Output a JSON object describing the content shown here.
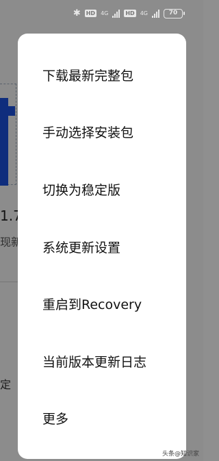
{
  "status_bar": {
    "bluetooth_icon": "bluetooth-icon",
    "hd_badge": "HD",
    "net_label": "4G",
    "battery_level": "70"
  },
  "background": {
    "version_fragment": "1.7",
    "subtitle_fragment": "现新",
    "setting_fragment": "定"
  },
  "menu": {
    "items": [
      {
        "label": "下载最新完整包"
      },
      {
        "label": "手动选择安装包"
      },
      {
        "label": "切换为稳定版"
      },
      {
        "label": "系统更新设置"
      },
      {
        "label": "重启到Recovery"
      },
      {
        "label": "当前版本更新日志"
      },
      {
        "label": "更多"
      }
    ]
  },
  "watermark": "头条@知识家"
}
